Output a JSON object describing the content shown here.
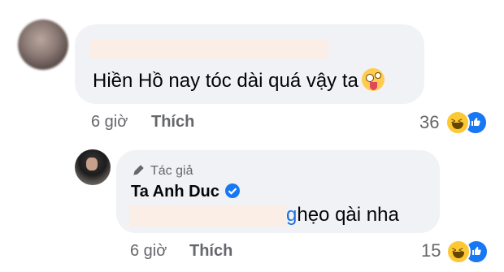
{
  "comment1": {
    "text": "Hiền Hồ nay tóc dài quá vậy ta",
    "emoji": "zany-face-emoji",
    "time": "6 giờ",
    "like_label": "Thích",
    "reaction_count": "36",
    "reactions": [
      "haha",
      "like"
    ]
  },
  "reply": {
    "author_badge": "Tác giả",
    "author_name": "Ta Anh Duc",
    "verified_icon": "verified-check-icon",
    "text_prefix": "g",
    "text": "hẹo qài nha",
    "time": "6 giờ",
    "like_label": "Thích",
    "reaction_count": "15",
    "reactions": [
      "haha",
      "like"
    ]
  },
  "colors": {
    "bubble": "#f0f2f5",
    "meta": "#65676b",
    "like_blue": "#1877f2",
    "haha_yellow": "#fcc934"
  }
}
